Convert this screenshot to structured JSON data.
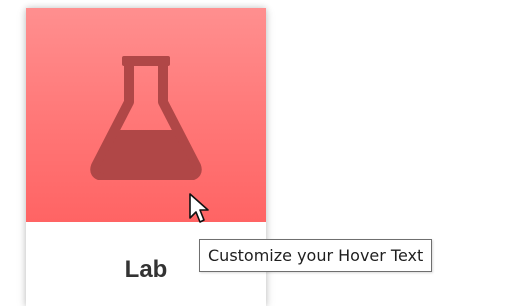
{
  "tile": {
    "label": "Lab",
    "icon": "flask-icon",
    "background_color": "#ff7a7a",
    "icon_color": "#b04444"
  },
  "tooltip": {
    "text": "Customize your Hover Text"
  },
  "cursor": {
    "icon": "mouse-pointer-icon"
  }
}
